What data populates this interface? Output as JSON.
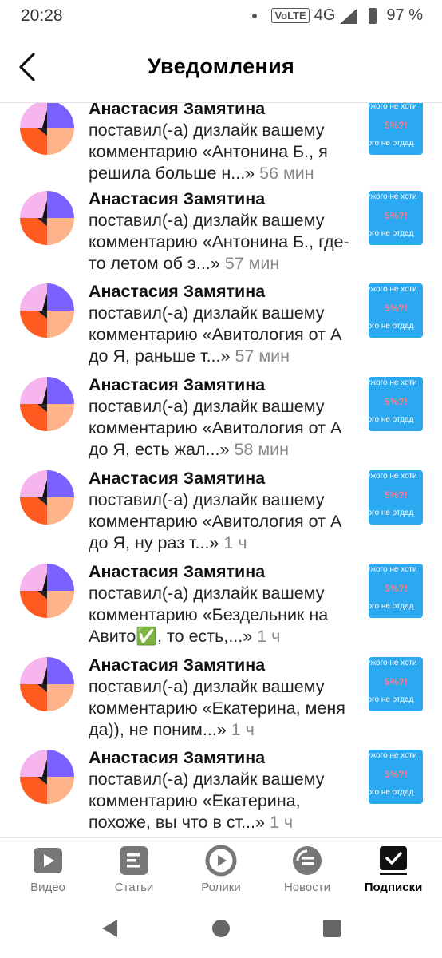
{
  "status_bar": {
    "time": "20:28",
    "volte": "VoLTE",
    "network": "4G",
    "battery": "97 %"
  },
  "header": {
    "title": "Уведомления"
  },
  "notifications": [
    {
      "name": "Анастасия Замятина",
      "text": "поставил(-а) дизлайк вашему комментарию «Антонина Б., я решила больше н...»",
      "time": "56 мин"
    },
    {
      "name": "Анастасия Замятина",
      "text": "поставил(-а) дизлайк вашему комментарию «Антонина Б., где-то летом об э...»",
      "time": "57 мин"
    },
    {
      "name": "Анастасия Замятина",
      "text": "поставил(-а) дизлайк вашему комментарию «Авитология от А до Я, раньше т...»",
      "time": "57 мин"
    },
    {
      "name": "Анастасия Замятина",
      "text": "поставил(-а) дизлайк вашему комментарию «Авитология от А до Я, есть жал...»",
      "time": "58 мин"
    },
    {
      "name": "Анастасия Замятина",
      "text": "поставил(-а) дизлайк вашему комментарию «Авитология от А до Я, ну раз т...»",
      "time": "1 ч"
    },
    {
      "name": "Анастасия Замятина",
      "text": "поставил(-а) дизлайк вашему комментарию «Бездельник на Авито✅, то есть,...»",
      "time": "1 ч"
    },
    {
      "name": "Анастасия Замятина",
      "text": "поставил(-а) дизлайк вашему комментарию «Екатерина, меня да)), не поним...»",
      "time": "1 ч"
    },
    {
      "name": "Анастасия Замятина",
      "text": "поставил(-а) дизлайк вашему комментарию «Екатерина, похоже, вы что в ст...»",
      "time": "1 ч"
    }
  ],
  "thumbnail": {
    "line1": "чужого не хоти",
    "line2": "5%?!",
    "line3": "кого не отдад"
  },
  "bottom_nav": [
    {
      "label": "Видео",
      "icon": "video-icon",
      "active": false
    },
    {
      "label": "Статьи",
      "icon": "articles-icon",
      "active": false
    },
    {
      "label": "Ролики",
      "icon": "shorts-icon",
      "active": false
    },
    {
      "label": "Новости",
      "icon": "news-icon",
      "active": false
    },
    {
      "label": "Подписки",
      "icon": "subscriptions-icon",
      "active": true
    }
  ],
  "colors": {
    "thumb_bg": "#2aa9f0",
    "nav_icon_inactive": "#777777",
    "avatar_purple": "#7b61ff",
    "avatar_pink": "#f7b5f0",
    "avatar_orange": "#ff5a1f",
    "avatar_peach": "#ffb38a"
  }
}
